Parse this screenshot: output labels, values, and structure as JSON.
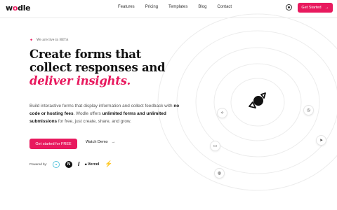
{
  "brand": {
    "logo_text": "wodle",
    "accent": "#e8195e"
  },
  "nav": {
    "items": [
      {
        "label": "Features"
      },
      {
        "label": "Pricing"
      },
      {
        "label": "Templates"
      },
      {
        "label": "Blog"
      },
      {
        "label": "Contact"
      }
    ],
    "theme_icon": "sun-icon",
    "cta_label": "Get Started",
    "cta_icon": "arrow-right-icon"
  },
  "hero": {
    "badge": "We are live in BETA",
    "headline_plain": "Create forms that collect responses and",
    "headline_accent": "deliver insights.",
    "desc_1": "Build interactive forms that display information and collect feedback with ",
    "desc_b1": "no code or hosting fees",
    "desc_2": ". Wodle offers ",
    "desc_b2": "unlimited forms and unlimited submissions",
    "desc_3": " for free, just create, share, and grow.",
    "primary_cta": "Get started for FREE",
    "secondary_cta": "Watch Demo",
    "secondary_icon": "arrow-right-icon"
  },
  "powered_by": {
    "label": "Powered by:",
    "logos": [
      "react-logo",
      "next-logo",
      "slash-logo",
      "Vercel",
      "supabase-logo"
    ]
  },
  "floating_icons": [
    "sparkle-icon",
    "clock-icon",
    "message-icon",
    "send-icon",
    "globe-icon",
    "satellite-icon"
  ]
}
